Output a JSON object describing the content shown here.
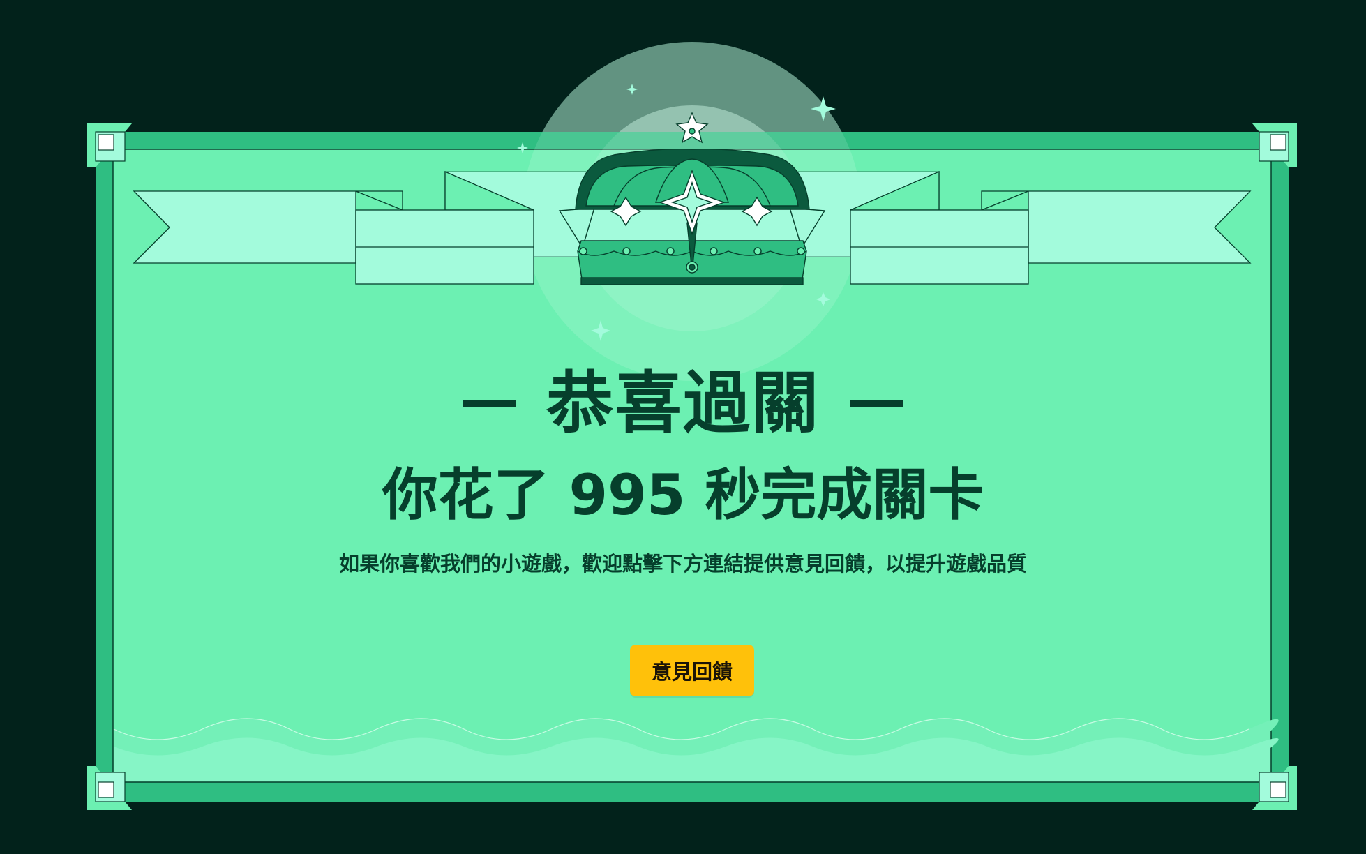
{
  "screen": "level-complete",
  "title": "恭喜過關",
  "completion_message": "你花了 995 秒完成關卡",
  "completion_seconds": 995,
  "description": "如果你喜歡我們的小遊戲，歡迎點擊下方連結提供意見回饋，以提升遊戲品質",
  "feedback_button_label": "意見回饋",
  "colors": {
    "background": "#02221b",
    "frame": "#2fbe82",
    "panel": "#6cf0b2",
    "ribbon": "#a3fbdc",
    "crown": "#2fbe82",
    "text": "#063f2c",
    "button": "#ffc10a"
  },
  "icons": [
    "crown-icon",
    "ribbon-banner",
    "sparkle-icon",
    "corner-ornament-icon"
  ]
}
